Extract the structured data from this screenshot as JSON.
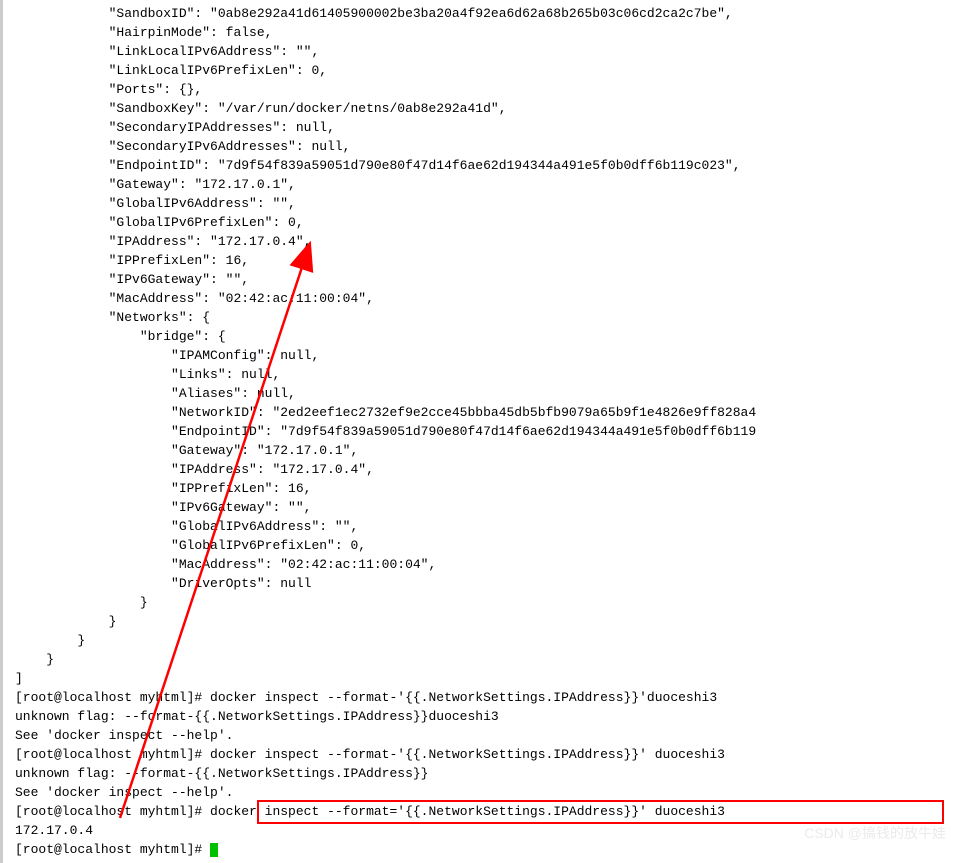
{
  "json_output": {
    "SandboxID": "\"0ab8e292a41d61405900002be3ba20a4f92ea6d62a68b265b03c06cd2ca2c7be\",",
    "HairpinMode": "false,",
    "LinkLocalIPv6Address": "\"\",",
    "LinkLocalIPv6PrefixLen": "0,",
    "Ports": "{},",
    "SandboxKey": "\"/var/run/docker/netns/0ab8e292a41d\",",
    "SecondaryIPAddresses": "null,",
    "SecondaryIPv6Addresses": "null,",
    "EndpointID": "\"7d9f54f839a59051d790e80f47d14f6ae62d194344a491e5f0b0dff6b119c023\",",
    "Gateway": "\"172.17.0.1\",",
    "GlobalIPv6Address": "\"\",",
    "GlobalIPv6PrefixLen": "0,",
    "IPAddress": "\"172.17.0.4\",",
    "IPPrefixLen": "16,",
    "IPv6Gateway": "\"\",",
    "MacAddress": "\"02:42:ac:11:00:04\",",
    "Networks_open": "{",
    "bridge_open": "{",
    "bridge": {
      "IPAMConfig": "null,",
      "Links": "null,",
      "Aliases": "null,",
      "NetworkID": "\"2ed2eef1ec2732ef9e2cce45bbba45db5bfb9079a65b9f1e4826e9ff828a4",
      "EndpointID": "\"7d9f54f839a59051d790e80f47d14f6ae62d194344a491e5f0b0dff6b119",
      "Gateway": "\"172.17.0.1\",",
      "IPAddress": "\"172.17.0.4\",",
      "IPPrefixLen": "16,",
      "IPv6Gateway": "\"\",",
      "GlobalIPv6Address": "\"\",",
      "GlobalIPv6PrefixLen": "0,",
      "MacAddress": "\"02:42:ac:11:00:04\",",
      "DriverOpts": "null"
    }
  },
  "shell": {
    "prompt": "[root@localhost myhtml]# ",
    "cmd1": "docker inspect --format-'{{.NetworkSettings.IPAddress}}'duoceshi3",
    "err1_line1": "unknown flag: --format-{{.NetworkSettings.IPAddress}}duoceshi3",
    "err1_line2": "See 'docker inspect --help'.",
    "cmd2": "docker inspect --format-'{{.NetworkSettings.IPAddress}}' duoceshi3",
    "err2_line1": "unknown flag: --format-{{.NetworkSettings.IPAddress}}",
    "err2_line2": "See 'docker inspect --help'.",
    "cmd3": "docker inspect --format='{{.NetworkSettings.IPAddress}}' duoceshi3",
    "result": "172.17.0.4",
    "prompt_last": "[root@localhost myhtml]# "
  },
  "watermark": "CSDN @搞钱的放牛娃"
}
